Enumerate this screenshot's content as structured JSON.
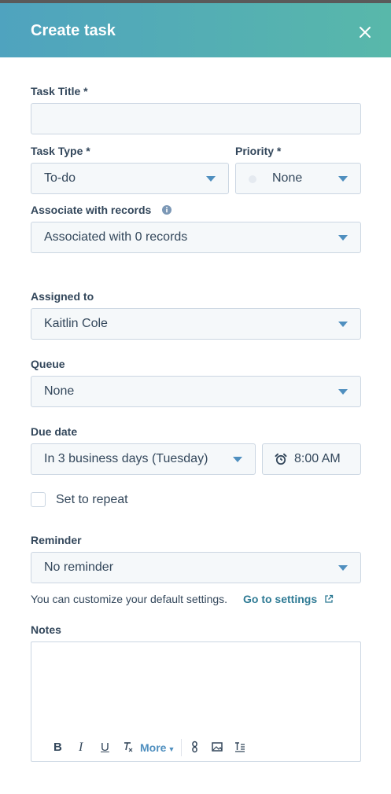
{
  "header": {
    "title": "Create task"
  },
  "task_title": {
    "label": "Task Title *",
    "value": ""
  },
  "task_type": {
    "label": "Task Type *",
    "value": "To-do"
  },
  "priority": {
    "label": "Priority *",
    "value": "None"
  },
  "associate": {
    "label": "Associate with records",
    "value": "Associated with 0 records"
  },
  "assigned_to": {
    "label": "Assigned to",
    "value": "Kaitlin Cole"
  },
  "queue": {
    "label": "Queue",
    "value": "None"
  },
  "due_date": {
    "label": "Due date",
    "value": "In 3 business days (Tuesday)",
    "time": "8:00 AM"
  },
  "repeat": {
    "label": "Set to repeat",
    "checked": false
  },
  "reminder": {
    "label": "Reminder",
    "value": "No reminder"
  },
  "settings": {
    "helper": "You can customize your default settings.",
    "link": "Go to settings"
  },
  "notes": {
    "label": "Notes",
    "toolbar": {
      "bold": "B",
      "italic": "I",
      "underline": "U",
      "more": "More"
    }
  },
  "colors": {
    "header_start": "#4fa3bf",
    "header_end": "#58b8aa",
    "accent": "#4f8fbf",
    "link": "#2e7a94"
  }
}
